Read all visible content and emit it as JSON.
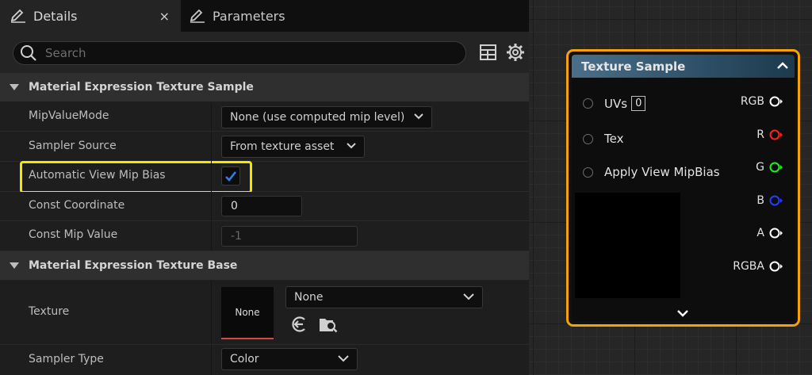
{
  "tabs": [
    {
      "label": "Details"
    },
    {
      "label": "Parameters"
    }
  ],
  "tab_close": "×",
  "search": {
    "placeholder": "Search",
    "value": ""
  },
  "sections": [
    {
      "title": "Material Expression Texture Sample"
    },
    {
      "title": "Material Expression Texture Base"
    }
  ],
  "properties": {
    "mip_value_mode": {
      "label": "MipValueMode",
      "value": "None (use computed mip level)"
    },
    "sampler_source": {
      "label": "Sampler Source",
      "value": "From texture asset"
    },
    "auto_view_mip_bias": {
      "label": "Automatic View Mip Bias",
      "checked": true
    },
    "const_coordinate": {
      "label": "Const Coordinate",
      "value": "0"
    },
    "const_mip_value": {
      "label": "Const Mip Value",
      "value": "-1"
    },
    "texture": {
      "label": "Texture",
      "thumbnail": "None",
      "asset": "None"
    },
    "sampler_type": {
      "label": "Sampler Type",
      "value": "Color"
    }
  },
  "node": {
    "title": "Texture Sample",
    "inputs": [
      {
        "label": "UVs",
        "value": "0"
      },
      {
        "label": "Tex"
      },
      {
        "label": "Apply View MipBias"
      }
    ],
    "outputs": [
      {
        "label": "RGB",
        "color": "#ffffff"
      },
      {
        "label": "R",
        "color": "#ff2020"
      },
      {
        "label": "G",
        "color": "#22ee22"
      },
      {
        "label": "B",
        "color": "#2a3cff"
      },
      {
        "label": "A",
        "color": "#ffffff"
      },
      {
        "label": "RGBA",
        "color": "#ffffff"
      }
    ]
  },
  "colors": {
    "highlight": "#f3e600",
    "node_border": "#f3a20c",
    "check": "#2d7ff0"
  },
  "icons": [
    "pencil-icon",
    "close-icon",
    "search-icon",
    "grid-icon",
    "gear-icon",
    "triangle-down-icon",
    "chevron-down-icon",
    "checkmark-icon",
    "use-selected-icon",
    "browse-icon",
    "collapse-icon",
    "expand-icon"
  ]
}
